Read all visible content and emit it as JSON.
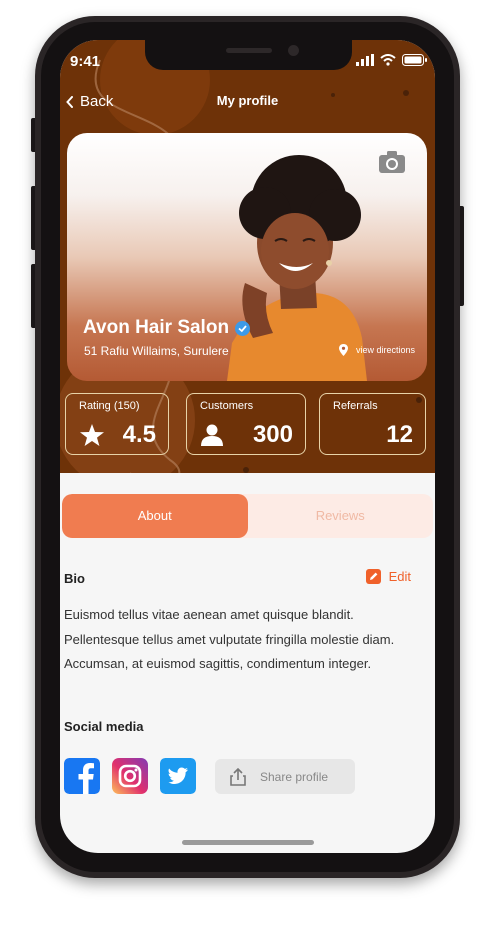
{
  "status_bar": {
    "time": "9:41"
  },
  "nav": {
    "back_label": "Back",
    "title": "My profile"
  },
  "profile": {
    "name": "Avon Hair Salon",
    "address": "51 Rafiu Willaims, Surulere",
    "directions_label": "view directions",
    "verified": true
  },
  "stats": [
    {
      "label": "Rating (150)",
      "value": "4.5",
      "icon": "star-icon"
    },
    {
      "label": "Customers",
      "value": "300",
      "icon": "person-icon"
    },
    {
      "label": "Referrals",
      "value": "12",
      "icon": ""
    }
  ],
  "tabs": [
    {
      "label": "About",
      "active": true
    },
    {
      "label": "Reviews",
      "active": false
    }
  ],
  "bio": {
    "title": "Bio",
    "edit_label": "Edit",
    "lines": [
      "Euismod tellus vitae aenean amet quisque blandit.",
      "Pellentesque tellus amet vulputate fringilla molestie diam.",
      "Accumsan, at euismod sagittis, condimentum integer."
    ]
  },
  "social": {
    "title": "Social media",
    "networks": [
      "facebook-icon",
      "instagram-icon",
      "twitter-icon"
    ],
    "share_label": "Share profile"
  },
  "colors": {
    "header_bg": "#6e3208",
    "accent": "#f07c50",
    "edit": "#f0612a",
    "facebook": "#1877f2",
    "twitter": "#1d9bf0"
  }
}
